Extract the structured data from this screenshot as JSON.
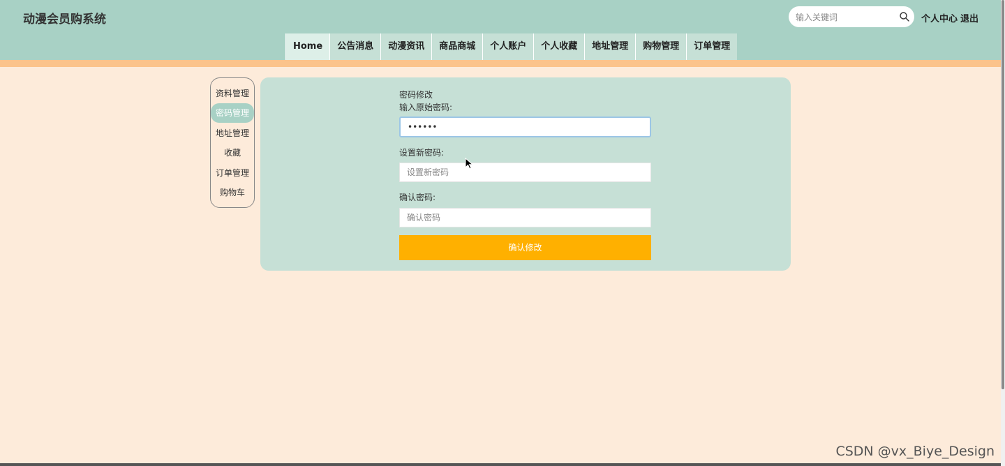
{
  "header": {
    "site_title": "动漫会员购系统",
    "search_placeholder": "输入关键词",
    "personal_center": "个人中心",
    "logout": "退出"
  },
  "nav": {
    "items": [
      "Home",
      "公告消息",
      "动漫资讯",
      "商品商城",
      "个人账户",
      "个人收藏",
      "地址管理",
      "购物管理",
      "订单管理"
    ]
  },
  "sidebar": {
    "items": [
      "资料管理",
      "密码管理",
      "地址管理",
      "收藏",
      "订单管理",
      "购物车"
    ],
    "active": "密码管理"
  },
  "form": {
    "title": "密码修改",
    "old_password_label": "输入原始密码:",
    "old_password_value": "••••••",
    "new_password_label": "设置新密码:",
    "new_password_placeholder": "设置新密码",
    "confirm_label": "确认密码:",
    "confirm_placeholder": "确认密码",
    "submit_label": "确认修改"
  },
  "watermark": "CSDN @vx_Biye_Design",
  "colors": {
    "header_bg": "#a8d1c5",
    "page_bg": "#fdebda",
    "strip": "#fbc38b",
    "panel_bg": "#c6e0d6",
    "button": "#ffb000"
  }
}
